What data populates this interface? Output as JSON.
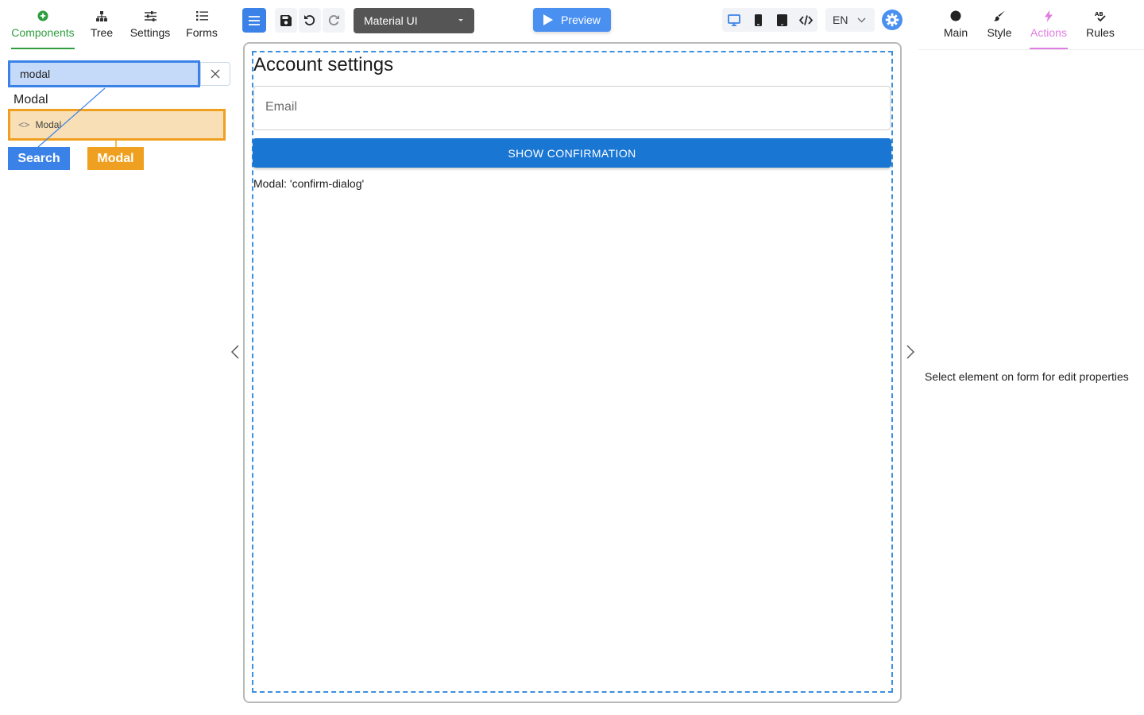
{
  "left_tabs": [
    {
      "label": "Components"
    },
    {
      "label": "Tree"
    },
    {
      "label": "Settings"
    },
    {
      "label": "Forms"
    }
  ],
  "search": {
    "value": "modal",
    "placeholder": ""
  },
  "component_list": {
    "group_title": "Modal",
    "items": [
      {
        "label": "Modal"
      }
    ]
  },
  "hints": {
    "search": "Search",
    "modal": "Modal"
  },
  "toolbar": {
    "theme": "Material UI",
    "preview_label": "Preview",
    "language": "EN"
  },
  "right_tabs": [
    {
      "label": "Main"
    },
    {
      "label": "Style"
    },
    {
      "label": "Actions"
    },
    {
      "label": "Rules"
    }
  ],
  "right_panel": {
    "empty_message": "Select element on form for edit properties"
  },
  "form": {
    "title": "Account settings",
    "email_placeholder": "Email",
    "button_label": "SHOW CONFIRMATION",
    "modal_placeholder": "Modal: 'confirm-dialog'"
  },
  "colors": {
    "accent_green": "#2e9e3e",
    "accent_blue": "#3b82e8",
    "accent_orange": "#f0a020",
    "primary_button": "#1976d2",
    "actions_tab": "#e07de0"
  },
  "icons": {
    "components": "plus-circle-icon",
    "tree": "hierarchy-icon",
    "settings": "sliders-icon",
    "forms": "list-icon",
    "main": "circle-icon",
    "style": "brush-icon",
    "actions": "lightning-icon",
    "rules": "spellcheck-icon"
  }
}
